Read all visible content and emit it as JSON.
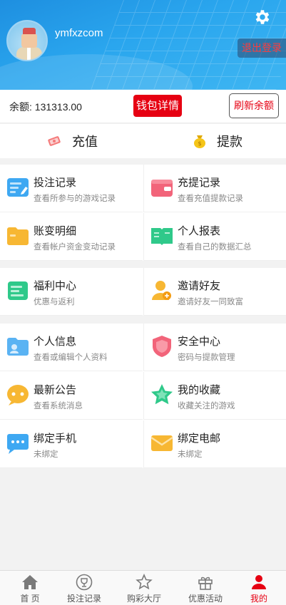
{
  "header": {
    "username": "ymfxzcom",
    "logout_label": "退出登录",
    "settings_icon": "gear-icon"
  },
  "balance": {
    "label": "余额: 131313.00",
    "wallet_details_label": "钱包详情",
    "refresh_label": "刷新余额"
  },
  "money": {
    "recharge_label": "充值",
    "withdraw_label": "提款"
  },
  "menu": {
    "bet_records": {
      "title": "投注记录",
      "subtitle": "查看所参与的游戏记录"
    },
    "deposit_withdraw_records": {
      "title": "充提记录",
      "subtitle": "查看充值提款记录"
    },
    "account_changes": {
      "title": "账变明细",
      "subtitle": "查看帐户资金变动记录"
    },
    "personal_report": {
      "title": "个人报表",
      "subtitle": "查看自己的数据汇总"
    },
    "welfare_center": {
      "title": "福利中心",
      "subtitle": "优惠与返利"
    },
    "invite_friends": {
      "title": "邀请好友",
      "subtitle": "邀请好友一同致富"
    },
    "personal_info": {
      "title": "个人信息",
      "subtitle": "查看或编辑个人资料"
    },
    "security_center": {
      "title": "安全中心",
      "subtitle": "密码与提款管理"
    },
    "latest_notice": {
      "title": "最新公告",
      "subtitle": "查看系统消息"
    },
    "my_favorites": {
      "title": "我的收藏",
      "subtitle": "收藏关注的游戏"
    },
    "bind_phone": {
      "title": "绑定手机",
      "subtitle": "未绑定"
    },
    "bind_email": {
      "title": "绑定电邮",
      "subtitle": "未绑定"
    }
  },
  "bottom_nav": {
    "home": "首 页",
    "bet_records": "投注记录",
    "lottery_hall": "购彩大厅",
    "promotions": "优惠活动",
    "mine": "我的"
  },
  "colors": {
    "accent_red": "#e60012",
    "header_blue": "#2aa6ee"
  }
}
